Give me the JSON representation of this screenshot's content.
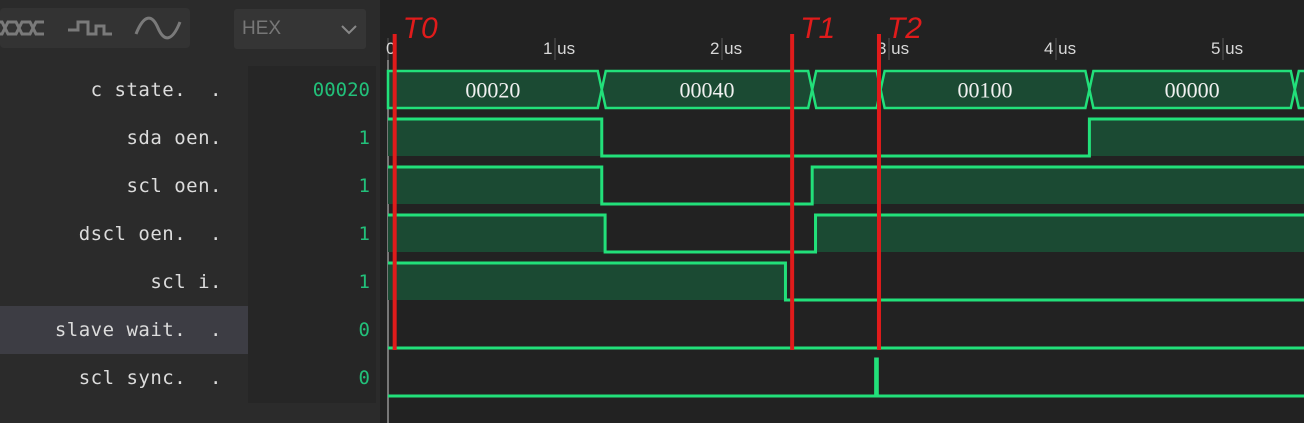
{
  "toolbar": {
    "buttons": [
      {
        "icon": "bus-waveform-icon"
      },
      {
        "icon": "step-waveform-icon"
      },
      {
        "icon": "analog-waveform-icon"
      }
    ],
    "radix": {
      "value": "HEX"
    }
  },
  "signals": [
    {
      "name": "c state.  .",
      "value": "00020"
    },
    {
      "name": "sda oen.",
      "value": "1"
    },
    {
      "name": "scl oen.",
      "value": "1"
    },
    {
      "name": "dscl oen.  .",
      "value": "1"
    },
    {
      "name": "scl i.",
      "value": "1"
    },
    {
      "name": "slave wait.  .",
      "value": "0"
    },
    {
      "name": "scl sync.  .",
      "value": "0"
    }
  ],
  "selected_row": 5,
  "timeline": {
    "ticks": [
      {
        "t": 0,
        "label": "0"
      },
      {
        "t": 1,
        "label": "1 us"
      },
      {
        "t": 2,
        "label": "2 us"
      },
      {
        "t": 3,
        "label": "3 us"
      },
      {
        "t": 4,
        "label": "4 us"
      },
      {
        "t": 5,
        "label": "5 us"
      }
    ]
  },
  "bus_segments": [
    {
      "t0": 0.0,
      "t1": 1.28,
      "label": "00020"
    },
    {
      "t0": 1.28,
      "t1": 2.54,
      "label": "00040"
    },
    {
      "t0": 2.54,
      "t1": 2.95,
      "label": ""
    },
    {
      "t0": 2.95,
      "t1": 4.2,
      "label": "00100"
    },
    {
      "t0": 4.2,
      "t1": 5.43,
      "label": "00000"
    },
    {
      "t0": 5.43,
      "t1": 5.6,
      "label": ""
    }
  ],
  "digital_waves": [
    {
      "row": 1,
      "segments": [
        [
          0,
          1.28,
          1
        ],
        [
          1.28,
          4.2,
          0
        ],
        [
          4.2,
          5.6,
          1
        ]
      ]
    },
    {
      "row": 2,
      "segments": [
        [
          0,
          1.28,
          1
        ],
        [
          1.28,
          2.54,
          0
        ],
        [
          2.54,
          5.6,
          1
        ]
      ]
    },
    {
      "row": 3,
      "segments": [
        [
          0,
          1.3,
          1
        ],
        [
          1.3,
          2.56,
          0
        ],
        [
          2.56,
          5.6,
          1
        ]
      ]
    },
    {
      "row": 4,
      "segments": [
        [
          0,
          2.38,
          1
        ],
        [
          2.38,
          5.6,
          0
        ]
      ]
    },
    {
      "row": 5,
      "segments": [
        [
          0,
          5.6,
          0
        ]
      ]
    },
    {
      "row": 6,
      "segments": [
        [
          0,
          2.92,
          0
        ],
        [
          2.92,
          2.93,
          1
        ],
        [
          2.93,
          5.6,
          0
        ]
      ]
    }
  ],
  "markers": [
    {
      "t": 0.04,
      "label": "T0"
    },
    {
      "t": 2.42,
      "label": "T1"
    },
    {
      "t": 2.94,
      "label": "T2"
    }
  ],
  "colors": {
    "wave": "#22e07a",
    "fill": "#1b4a33",
    "marker": "#e01b1b",
    "value_text": "#22c07a"
  }
}
